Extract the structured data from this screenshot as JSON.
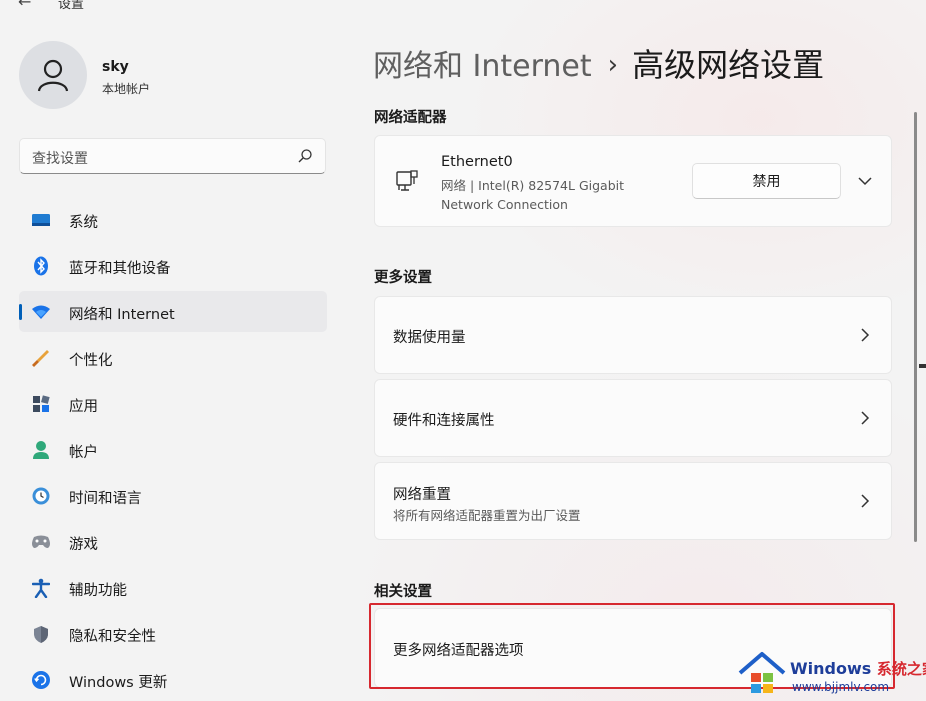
{
  "window": {
    "back_icon": "back-arrow-icon",
    "title": "设置"
  },
  "profile": {
    "name": "sky",
    "account_type": "本地帐户"
  },
  "search": {
    "placeholder": "查找设置",
    "icon": "search-icon"
  },
  "sidebar": {
    "items": [
      {
        "label": "系统",
        "icon": "display-icon",
        "active": false
      },
      {
        "label": "蓝牙和其他设备",
        "icon": "bluetooth-icon",
        "active": false
      },
      {
        "label": "网络和 Internet",
        "icon": "wifi-icon",
        "active": true
      },
      {
        "label": "个性化",
        "icon": "brush-icon",
        "active": false
      },
      {
        "label": "应用",
        "icon": "apps-icon",
        "active": false
      },
      {
        "label": "帐户",
        "icon": "account-icon",
        "active": false
      },
      {
        "label": "时间和语言",
        "icon": "clock-globe-icon",
        "active": false
      },
      {
        "label": "游戏",
        "icon": "gamepad-icon",
        "active": false
      },
      {
        "label": "辅助功能",
        "icon": "accessibility-icon",
        "active": false
      },
      {
        "label": "隐私和安全性",
        "icon": "shield-icon",
        "active": false
      },
      {
        "label": "Windows 更新",
        "icon": "windows-update-icon",
        "active": false
      }
    ]
  },
  "breadcrumb": {
    "parent": "网络和 Internet",
    "separator": "›",
    "current": "高级网络设置"
  },
  "adapters": {
    "title": "网络适配器",
    "items": [
      {
        "name": "Ethernet0",
        "description": "网络 | Intel(R) 82574L Gigabit Network Connection",
        "button_label": "禁用"
      }
    ]
  },
  "more_settings": {
    "title": "更多设置",
    "items": [
      {
        "label": "数据使用量",
        "sublabel": ""
      },
      {
        "label": "硬件和连接属性",
        "sublabel": ""
      },
      {
        "label": "网络重置",
        "sublabel": "将所有网络适配器重置为出厂设置"
      }
    ]
  },
  "related_settings": {
    "title": "相关设置",
    "items": [
      {
        "label": "更多网络适配器选项"
      }
    ]
  },
  "watermark": {
    "title": "Windows",
    "title_cn": "系统之家",
    "url": "www.bjjmlv.com"
  },
  "colors": {
    "accent": "#005fb8",
    "highlight": "#d6282f",
    "background": "#f3f3f3",
    "card": "#fbfbfb"
  }
}
